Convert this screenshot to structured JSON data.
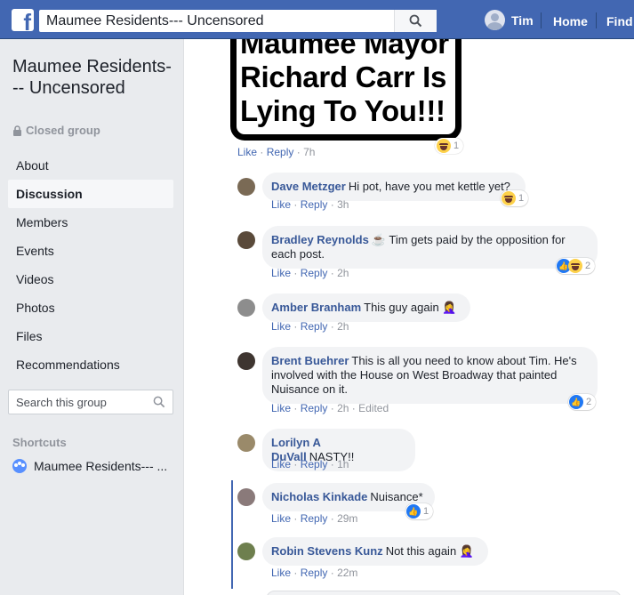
{
  "topbar": {
    "logo": "f",
    "search_value": "Maumee Residents--- Uncensored",
    "user_name": "Tim",
    "nav_home": "Home",
    "nav_find": "Find"
  },
  "sidebar": {
    "group_name": "Maumee Residents--- Uncensored",
    "privacy": "Closed group",
    "items": [
      {
        "label": "About"
      },
      {
        "label": "Discussion"
      },
      {
        "label": "Members"
      },
      {
        "label": "Events"
      },
      {
        "label": "Videos"
      },
      {
        "label": "Photos"
      },
      {
        "label": "Files"
      },
      {
        "label": "Recommendations"
      }
    ],
    "search_placeholder": "Search this group",
    "shortcuts_heading": "Shortcuts",
    "shortcut_item": "Maumee Residents--- ..."
  },
  "post": {
    "image_text": "Maumee Mayor Richard Carr Is Lying To You!!!",
    "reaction_count": "1",
    "like": "Like",
    "reply": "Reply",
    "time": "7h"
  },
  "comments": [
    {
      "author": "Dave Metzger",
      "text": "Hi pot, have you met kettle yet?",
      "like": "Like",
      "reply": "Reply",
      "time": "3h",
      "reactions": "haha",
      "count": "1",
      "avatar_color": "#7a6a55"
    },
    {
      "author": "Bradley Reynolds",
      "text": "☕ Tim gets paid by the opposition for each post.",
      "like": "Like",
      "reply": "Reply",
      "time": "2h",
      "reactions": "like,haha",
      "count": "2",
      "avatar_color": "#5a4a3a"
    },
    {
      "author": "Amber Branham",
      "text": "This guy again 🤦‍♀️",
      "like": "Like",
      "reply": "Reply",
      "time": "2h",
      "reactions": "",
      "count": "",
      "avatar_color": "#8d8d8d"
    },
    {
      "author": "Brent Buehrer",
      "text": "This is all you need to know about Tim. He's involved with the House on West Broadway that painted Nuisance on it.",
      "like": "Like",
      "reply": "Reply",
      "time": "2h",
      "edited": "Edited",
      "reactions": "like",
      "count": "2",
      "avatar_color": "#3e3530"
    },
    {
      "author": "Lorilyn A DuVall",
      "text": "NASTY!!",
      "like": "Like",
      "reply": "Reply",
      "time": "1h",
      "reactions": "",
      "count": "",
      "avatar_color": "#9a8a6a"
    },
    {
      "author": "Nicholas Kinkade",
      "text": "Nuisance*",
      "like": "Like",
      "reply": "Reply",
      "time": "29m",
      "reactions": "like",
      "count": "1",
      "avatar_color": "#8a7a7a"
    },
    {
      "author": "Robin Stevens Kunz",
      "text": "Not this again 🤦‍♀️",
      "like": "Like",
      "reply": "Reply",
      "time": "22m",
      "reactions": "",
      "count": "",
      "avatar_color": "#6e7f4e"
    }
  ],
  "separator": "·",
  "colors": {
    "brand": "#4267b2",
    "link": "#385898",
    "bubble": "#f2f3f5"
  }
}
